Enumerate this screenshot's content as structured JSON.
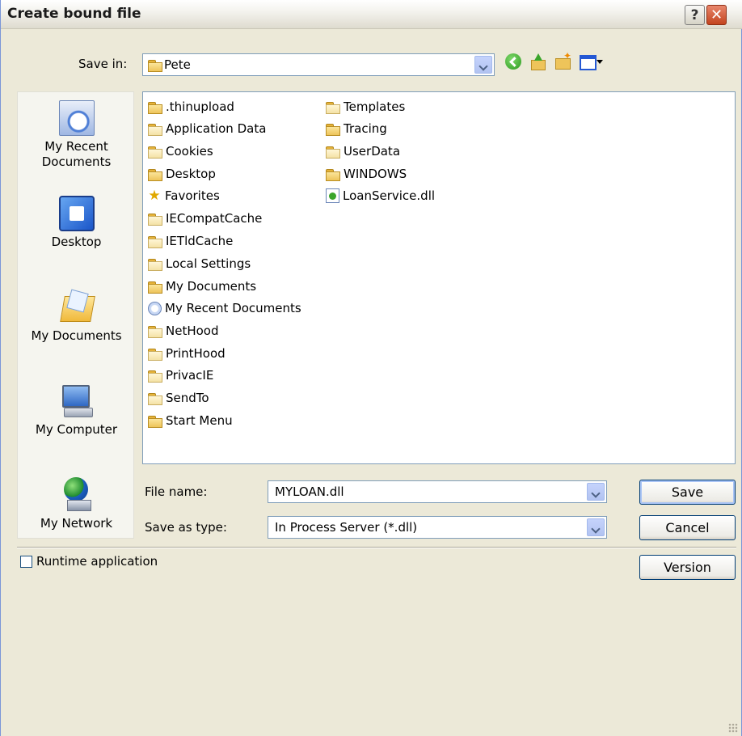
{
  "window": {
    "title": "Create bound file",
    "help_label": "?",
    "close_label": "✕"
  },
  "save_in": {
    "label": "Save in:",
    "value": "Pete"
  },
  "places": [
    {
      "label": "My Recent Documents",
      "icon": "recent-documents-icon"
    },
    {
      "label": "Desktop",
      "icon": "desktop-icon"
    },
    {
      "label": "My Documents",
      "icon": "my-documents-icon"
    },
    {
      "label": "My Computer",
      "icon": "my-computer-icon"
    },
    {
      "label": "My Network",
      "icon": "my-network-icon"
    }
  ],
  "files": {
    "col1": [
      {
        "name": ".thinupload",
        "icon": "folder-icon"
      },
      {
        "name": "Application Data",
        "icon": "folder-icon"
      },
      {
        "name": "Cookies",
        "icon": "folder-icon"
      },
      {
        "name": "Desktop",
        "icon": "folder-icon"
      },
      {
        "name": "Favorites",
        "icon": "star-icon"
      },
      {
        "name": "IECompatCache",
        "icon": "folder-icon"
      },
      {
        "name": "IETldCache",
        "icon": "folder-icon"
      },
      {
        "name": "Local Settings",
        "icon": "folder-icon"
      },
      {
        "name": "My Documents",
        "icon": "folder-icon"
      },
      {
        "name": "My Recent Documents",
        "icon": "recent-documents-icon"
      },
      {
        "name": "NetHood",
        "icon": "folder-icon"
      },
      {
        "name": "PrintHood",
        "icon": "folder-icon"
      },
      {
        "name": "PrivacIE",
        "icon": "folder-icon"
      },
      {
        "name": "SendTo",
        "icon": "folder-icon"
      },
      {
        "name": "Start Menu",
        "icon": "folder-icon"
      }
    ],
    "col2": [
      {
        "name": "Templates",
        "icon": "folder-icon"
      },
      {
        "name": "Tracing",
        "icon": "folder-icon"
      },
      {
        "name": "UserData",
        "icon": "folder-icon"
      },
      {
        "name": "WINDOWS",
        "icon": "folder-icon"
      },
      {
        "name": "LoanService.dll",
        "icon": "dll-file-icon"
      }
    ]
  },
  "file_name": {
    "label": "File name:",
    "value": "MYLOAN.dll"
  },
  "save_as_type": {
    "label": "Save as type:",
    "value": "In Process Server (*.dll)"
  },
  "buttons": {
    "save": "Save",
    "cancel": "Cancel",
    "version": "Version"
  },
  "runtime": {
    "label": "Runtime application",
    "checked": false
  }
}
